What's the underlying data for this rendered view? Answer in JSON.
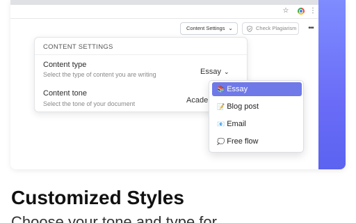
{
  "browser": {
    "icons": [
      "star-icon",
      "chrome-icon",
      "kebab-menu-icon"
    ]
  },
  "toolbar": {
    "content_settings_label": "Content Settings",
    "check_plagiarism_label": "Check Plagiarism"
  },
  "panel": {
    "title": "CONTENT SETTINGS",
    "content_type": {
      "label": "Content type",
      "description": "Select the type of content you are writing",
      "value": "Essay"
    },
    "content_tone": {
      "label": "Content tone",
      "description": "Select the tone of your document",
      "value": "Academic"
    }
  },
  "dropdown": {
    "options": [
      {
        "emoji": "📚",
        "label": "Essay",
        "selected": true
      },
      {
        "emoji": "📝",
        "label": "Blog post",
        "selected": false
      },
      {
        "emoji": "📧",
        "label": "Email",
        "selected": false
      },
      {
        "emoji": "💭",
        "label": "Free flow",
        "selected": false
      }
    ]
  },
  "hero": {
    "headline": "Customized Styles",
    "subline": "Choose your tone and type for"
  },
  "colors": {
    "accent_gradient_top": "#7e8cff",
    "accent_gradient_bottom": "#5b63f0",
    "selected_option": "#6f79e8"
  }
}
